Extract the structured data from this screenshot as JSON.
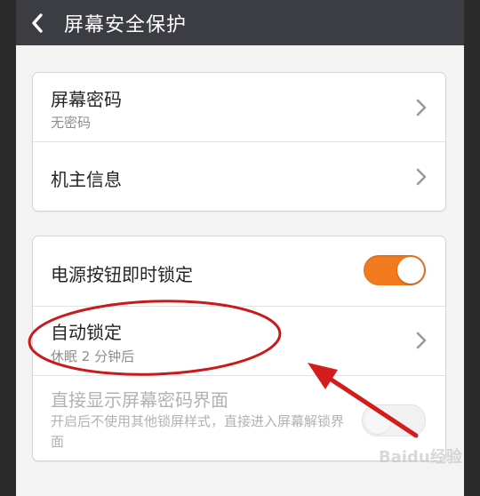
{
  "header": {
    "title": "屏幕安全保护"
  },
  "group1": {
    "screen_password": {
      "label": "屏幕密码",
      "value": "无密码"
    },
    "owner_info": {
      "label": "机主信息"
    }
  },
  "group2": {
    "power_lock": {
      "label": "电源按钮即时锁定",
      "toggle_on": true
    },
    "auto_lock": {
      "label": "自动锁定",
      "value": "休眠 2 分钟后"
    },
    "direct_password": {
      "label": "直接显示屏幕密码界面",
      "description": "开启后不使用其他锁屏样式，直接进入屏幕解锁界面",
      "toggle_on": false,
      "enabled": false
    }
  },
  "annotation": {
    "circle_color": "#c9191b",
    "arrow_color": "#d31c1c"
  },
  "watermark": {
    "brand": "Baidu经验"
  },
  "colors": {
    "accent": "#f27a1f",
    "titlebar": "#3b3d42"
  }
}
